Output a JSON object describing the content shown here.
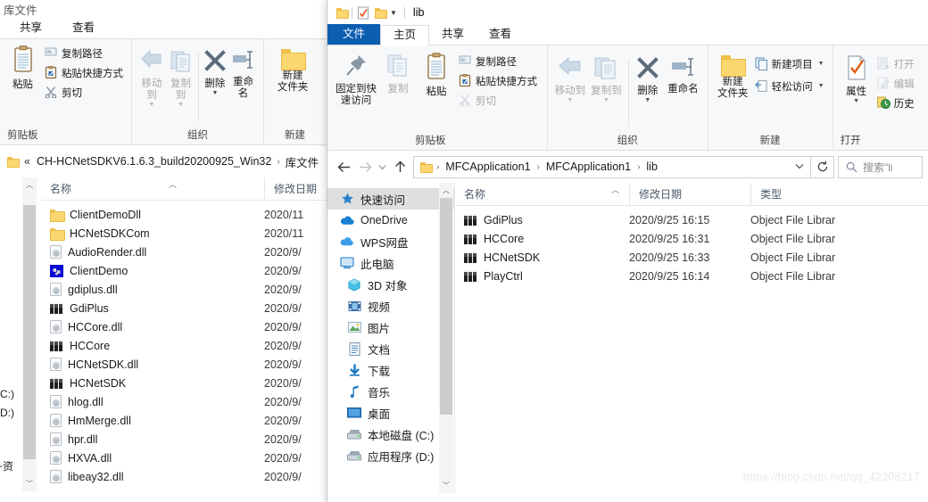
{
  "back_window": {
    "title": "库文件",
    "window_controls": [
      "maximize-icon",
      "close-icon"
    ],
    "tabs": [
      {
        "label": "共享",
        "active": false
      },
      {
        "label": "查看",
        "active": false
      }
    ],
    "ribbon": {
      "groups": [
        {
          "name": "剪贴板",
          "big": [
            {
              "label": "粘贴",
              "icon": "clipboard-icon",
              "dim": false
            }
          ],
          "small": [
            {
              "label": "复制路径",
              "icon": "copy-path-icon",
              "dim": false
            },
            {
              "label": "粘贴快捷方式",
              "icon": "paste-shortcut-icon",
              "dim": false
            },
            {
              "label": "剪切",
              "icon": "scissors-icon",
              "dim": false
            }
          ]
        },
        {
          "name": "组织",
          "big": [
            {
              "label": "移动到",
              "icon": "move-to-icon",
              "dim": true,
              "caret": true
            },
            {
              "label": "复制到",
              "icon": "copy-to-icon",
              "dim": true,
              "caret": true
            },
            {
              "label": "删除",
              "icon": "delete-x-icon",
              "dim": false,
              "caret": true
            },
            {
              "label": "重命名",
              "icon": "rename-icon",
              "dim": false,
              "caret": false
            }
          ]
        },
        {
          "name": "新建",
          "big": [
            {
              "label": "新建\n文件夹",
              "icon": "new-folder-icon",
              "dim": false
            }
          ]
        }
      ]
    },
    "address": {
      "overflow": "«",
      "crumbs": [
        "CH-HCNetSDKV6.1.6.3_build20200925_Win32",
        "库文件"
      ]
    },
    "columns": [
      "名称",
      "修改日期"
    ],
    "sort_column": "名称",
    "files": [
      {
        "name": "ClientDemoDll",
        "icon": "folder-icon",
        "date": "2020/11"
      },
      {
        "name": "HCNetSDKCom",
        "icon": "folder-icon",
        "date": "2020/11"
      },
      {
        "name": "AudioRender.dll",
        "icon": "dll-icon",
        "date": "2020/9/"
      },
      {
        "name": "ClientDemo",
        "icon": "exe-icon",
        "date": "2020/9/"
      },
      {
        "name": "gdiplus.dll",
        "icon": "dll-icon",
        "date": "2020/9/"
      },
      {
        "name": "GdiPlus",
        "icon": "library-icon",
        "date": "2020/9/"
      },
      {
        "name": "HCCore.dll",
        "icon": "dll-icon",
        "date": "2020/9/"
      },
      {
        "name": "HCCore",
        "icon": "library-icon",
        "date": "2020/9/"
      },
      {
        "name": "HCNetSDK.dll",
        "icon": "dll-icon",
        "date": "2020/9/"
      },
      {
        "name": "HCNetSDK",
        "icon": "library-icon",
        "date": "2020/9/"
      },
      {
        "name": "hlog.dll",
        "icon": "dll-icon",
        "date": "2020/9/"
      },
      {
        "name": "HmMerge.dll",
        "icon": "dll-icon",
        "date": "2020/9/"
      },
      {
        "name": "hpr.dll",
        "icon": "dll-icon",
        "date": "2020/9/"
      },
      {
        "name": "HXVA.dll",
        "icon": "dll-icon",
        "date": "2020/9/"
      },
      {
        "name": "libeay32.dll",
        "icon": "dll-icon",
        "date": "2020/9/"
      }
    ],
    "nav_fragments": [
      "C:)",
      "D:)",
      "+资"
    ]
  },
  "front_window": {
    "title": "lib",
    "quick_access_icons": [
      "folder-icon",
      "properties-icon",
      "new-folder-icon",
      "chevron-down-icon"
    ],
    "tabs": [
      {
        "label": "文件",
        "kind": "file"
      },
      {
        "label": "主页",
        "kind": "active"
      },
      {
        "label": "共享",
        "kind": "normal"
      },
      {
        "label": "查看",
        "kind": "normal"
      }
    ],
    "ribbon": {
      "groups": [
        {
          "name": "剪贴板",
          "big": [
            {
              "label": "固定到快\n速访问",
              "icon": "pin-icon",
              "dim": false
            },
            {
              "label": "复制",
              "icon": "copy-icon",
              "dim": true
            },
            {
              "label": "粘贴",
              "icon": "clipboard-icon",
              "dim": false
            }
          ],
          "small": [
            {
              "label": "复制路径",
              "icon": "copy-path-icon",
              "dim": false
            },
            {
              "label": "粘贴快捷方式",
              "icon": "paste-shortcut-icon",
              "dim": false
            },
            {
              "label": "剪切",
              "icon": "scissors-icon",
              "dim": true
            }
          ]
        },
        {
          "name": "组织",
          "big": [
            {
              "label": "移动到",
              "icon": "move-to-icon",
              "dim": true,
              "caret": true
            },
            {
              "label": "复制到",
              "icon": "copy-to-icon",
              "dim": true,
              "caret": true
            },
            {
              "label": "删除",
              "icon": "delete-x-icon",
              "dim": false,
              "caret": true
            },
            {
              "label": "重命名",
              "icon": "rename-icon",
              "dim": false,
              "caret": false
            }
          ]
        },
        {
          "name": "新建",
          "big": [
            {
              "label": "新建\n文件夹",
              "icon": "new-folder-icon",
              "dim": false
            }
          ],
          "small": [
            {
              "label": "新建项目",
              "icon": "new-item-icon",
              "dim": false,
              "caret": true
            },
            {
              "label": "轻松访问",
              "icon": "easy-access-icon",
              "dim": false,
              "caret": true
            }
          ]
        },
        {
          "name": "打开",
          "big": [
            {
              "label": "属性",
              "icon": "properties-icon",
              "dim": false,
              "caret": true
            }
          ],
          "small": [
            {
              "label": "打开",
              "icon": "open-icon",
              "dim": true,
              "caret": false
            },
            {
              "label": "编辑",
              "icon": "edit-icon",
              "dim": true,
              "caret": false
            },
            {
              "label": "历史",
              "icon": "history-icon",
              "dim": false,
              "caret": false
            }
          ]
        }
      ]
    },
    "address": {
      "crumbs": [
        "MFCApplication1",
        "MFCApplication1",
        "lib"
      ],
      "refresh_icon": "refresh-icon",
      "back_icon": "arrow-left-icon",
      "forward_icon": "arrow-right-icon",
      "recent_icon": "chevron-down-icon",
      "up_icon": "arrow-up-icon"
    },
    "search": {
      "placeholder": "搜索\"li",
      "icon": "search-icon"
    },
    "nav_items": [
      {
        "label": "快速访问",
        "icon": "quick-access-star-icon",
        "selected": true,
        "indent": false
      },
      {
        "label": "OneDrive",
        "icon": "onedrive-cloud-icon",
        "selected": false,
        "indent": false
      },
      {
        "label": "WPS网盘",
        "icon": "wps-cloud-icon",
        "selected": false,
        "indent": false
      },
      {
        "label": "此电脑",
        "icon": "this-pc-icon",
        "selected": false,
        "indent": false
      },
      {
        "label": "3D 对象",
        "icon": "3d-objects-icon",
        "selected": false,
        "indent": true
      },
      {
        "label": "视频",
        "icon": "videos-icon",
        "selected": false,
        "indent": true
      },
      {
        "label": "图片",
        "icon": "pictures-icon",
        "selected": false,
        "indent": true
      },
      {
        "label": "文档",
        "icon": "documents-icon",
        "selected": false,
        "indent": true
      },
      {
        "label": "下载",
        "icon": "downloads-icon",
        "selected": false,
        "indent": true
      },
      {
        "label": "音乐",
        "icon": "music-icon",
        "selected": false,
        "indent": true
      },
      {
        "label": "桌面",
        "icon": "desktop-icon",
        "selected": false,
        "indent": true
      },
      {
        "label": "本地磁盘 (C:)",
        "icon": "local-disk-icon",
        "selected": false,
        "indent": true
      },
      {
        "label": "应用程序 (D:)",
        "icon": "local-disk-icon",
        "selected": false,
        "indent": true
      }
    ],
    "columns": [
      "名称",
      "修改日期",
      "类型"
    ],
    "sort_column": "名称",
    "files": [
      {
        "name": "GdiPlus",
        "icon": "library-icon",
        "date": "2020/9/25 16:15",
        "type": "Object File Librar"
      },
      {
        "name": "HCCore",
        "icon": "library-icon",
        "date": "2020/9/25 16:31",
        "type": "Object File Librar"
      },
      {
        "name": "HCNetSDK",
        "icon": "library-icon",
        "date": "2020/9/25 16:33",
        "type": "Object File Librar"
      },
      {
        "name": "PlayCtrl",
        "icon": "library-icon",
        "date": "2020/9/25 16:14",
        "type": "Object File Librar"
      }
    ]
  },
  "watermark": "https://blog.csdn.net/qq_42308217"
}
